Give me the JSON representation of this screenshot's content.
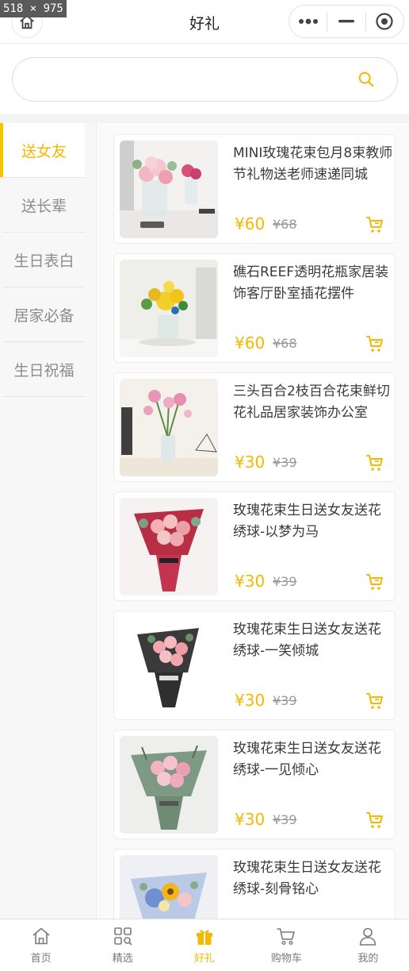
{
  "debug": {
    "size_badge": "518 × 975"
  },
  "header": {
    "title": "好礼"
  },
  "search": {
    "placeholder": "",
    "value": ""
  },
  "categories": [
    {
      "label": "送女友",
      "active": true
    },
    {
      "label": "送长辈",
      "active": false
    },
    {
      "label": "生日表白",
      "active": false
    },
    {
      "label": "居家必备",
      "active": false
    },
    {
      "label": "生日祝福",
      "active": false
    }
  ],
  "products": [
    {
      "name": "MINI玫瑰花束包月8束教师节礼物送老师速递同城",
      "price": "¥60",
      "old_price": "¥68",
      "image": "pink-roses-vase-photo"
    },
    {
      "name": "礁石REEF透明花瓶家居装饰客厅卧室插花摆件",
      "price": "¥60",
      "old_price": "¥68",
      "image": "yellow-flowers-vase-photo"
    },
    {
      "name": "三头百合2枝百合花束鲜切花礼品居家装饰办公室",
      "price": "¥30",
      "old_price": "¥39",
      "image": "lily-vase-photo"
    },
    {
      "name": "玫瑰花束生日送女友送花绣球-以梦为马",
      "price": "¥30",
      "old_price": "¥39",
      "image": "red-wrapped-bouquet-photo"
    },
    {
      "name": "玫瑰花束生日送女友送花绣球-一笑倾城",
      "price": "¥30",
      "old_price": "¥39",
      "image": "black-wrapped-bouquet-photo"
    },
    {
      "name": "玫瑰花束生日送女友送花绣球-一见倾心",
      "price": "¥30",
      "old_price": "¥39",
      "image": "green-wrapped-bouquet-photo"
    },
    {
      "name": "玫瑰花束生日送女友送花绣球-刻骨铭心",
      "price": "",
      "old_price": "",
      "image": "blue-sunflower-bouquet-photo"
    }
  ],
  "tabbar": [
    {
      "label": "首页",
      "icon": "home-icon",
      "active": false
    },
    {
      "label": "精选",
      "icon": "grid-search-icon",
      "active": false
    },
    {
      "label": "好礼",
      "icon": "gift-icon",
      "active": true
    },
    {
      "label": "购物车",
      "icon": "cart-icon",
      "active": false
    },
    {
      "label": "我的",
      "icon": "user-icon",
      "active": false
    }
  ],
  "colors": {
    "accent": "#f5b800",
    "text": "#3a3a3a",
    "muted": "#8c8c8c"
  }
}
